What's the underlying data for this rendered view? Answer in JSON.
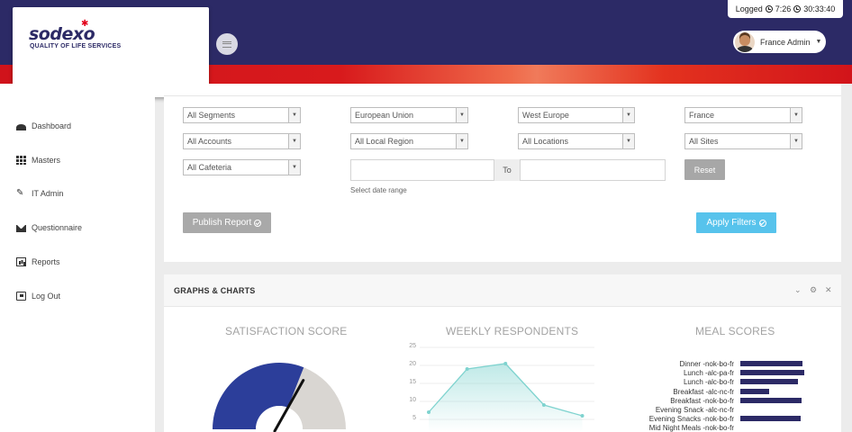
{
  "header": {
    "logged_label": "Logged",
    "logged_duration": "7:26",
    "logged_time": "30:33:40",
    "user_name": "France Admin"
  },
  "logo": {
    "wordmark": "sodexo",
    "tagline": "QUALITY OF LIFE SERVICES"
  },
  "sidebar": {
    "items": [
      {
        "label": "Dashboard",
        "icon": "dashboard-icon"
      },
      {
        "label": "Masters",
        "icon": "grid-icon"
      },
      {
        "label": "IT Admin",
        "icon": "user-edit-icon"
      },
      {
        "label": "Questionnaire",
        "icon": "envelope-icon"
      },
      {
        "label": "Reports",
        "icon": "bar-chart-icon"
      },
      {
        "label": "Log Out",
        "icon": "logout-icon"
      }
    ]
  },
  "filters": {
    "segment": "All Segments",
    "union": "European Union",
    "region": "West Europe",
    "country": "France",
    "account": "All Accounts",
    "local_region": "All Local Region",
    "location": "All Locations",
    "site": "All Sites",
    "cafeteria": "All Cafeteria",
    "date_separator": "To",
    "date_hint": "Select date range",
    "reset_label": "Reset",
    "publish_label": "Publish Report",
    "apply_label": "Apply Filters"
  },
  "graphs": {
    "title": "GRAPHS & CHARTS"
  },
  "colors": {
    "brand_navy": "#2c2a66",
    "brand_red": "#d0131b",
    "apply_blue": "#57c3ec",
    "gauge_blue": "#2c3e9a",
    "gauge_grey": "#d9d6d2",
    "line_teal": "#7fd3cf"
  },
  "chart_data": [
    {
      "type": "gauge",
      "title": "SATISFACTION SCORE",
      "value_fraction": 0.62
    },
    {
      "type": "line",
      "title": "WEEKLY RESPONDENTS",
      "y_ticks": [
        "25",
        "20",
        "15",
        "10",
        "5"
      ],
      "ylim": [
        5,
        25
      ],
      "values": [
        7,
        19,
        20.5,
        9,
        6
      ]
    },
    {
      "type": "bar",
      "title": "MEAL SCORES",
      "categories": [
        "Dinner -nok-bo-fr",
        "Lunch -alc-pa-fr",
        "Lunch -alc-bo-fr",
        "Breakfast -alc-nc-fr",
        "Breakfast -nok-bo-fr",
        "Evening Snack -alc-nc-fr",
        "Evening Snacks -nok-bo-fr",
        "Mid Night Meals -nok-bo-fr"
      ],
      "values": [
        69,
        71,
        64,
        32,
        68,
        0,
        67,
        0
      ],
      "xlim": [
        0,
        100
      ]
    }
  ]
}
